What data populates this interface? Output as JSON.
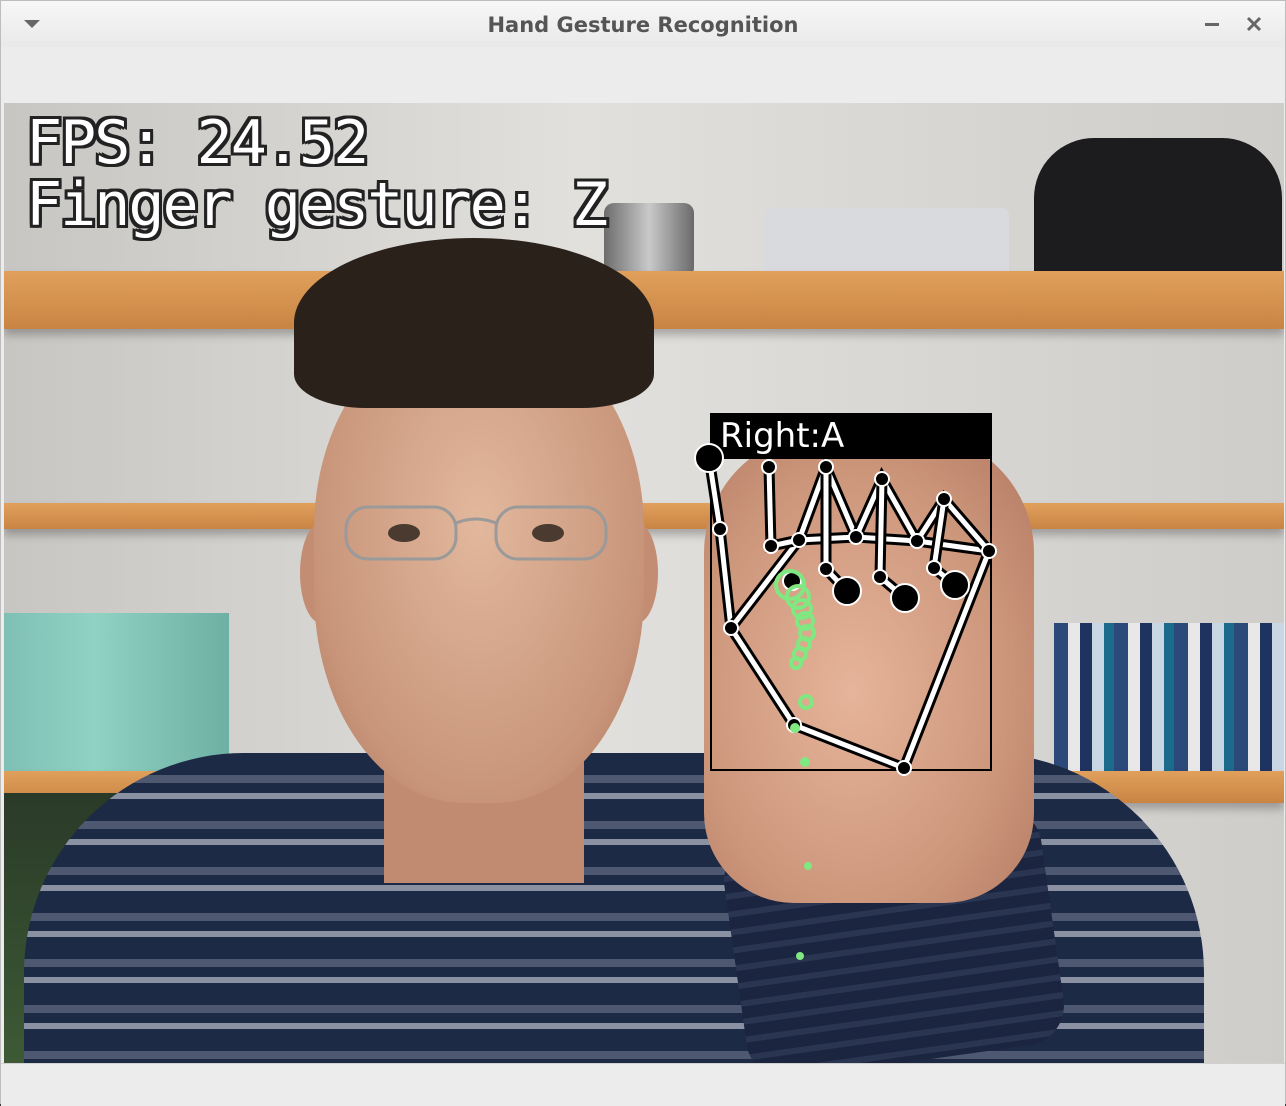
{
  "window": {
    "title": "Hand Gesture Recognition",
    "menu_icon": "chevron-down-icon",
    "minimize_icon": "minimize-icon",
    "close_icon": "close-icon"
  },
  "overlay": {
    "fps_text": "FPS: 24.52",
    "gesture_text": "Finger gesture: Z",
    "hand_label": "Right:A"
  },
  "colors": {
    "landmark": "#000000",
    "bone": "#ffffff",
    "trail": "#80e880"
  }
}
